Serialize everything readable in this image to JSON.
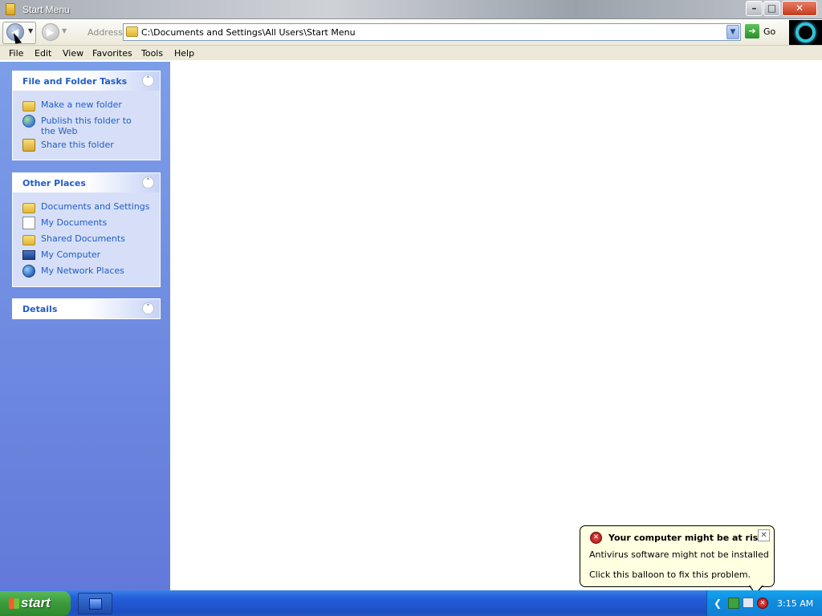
{
  "window": {
    "title": "Start Menu",
    "controls": {
      "minimize": "–",
      "maximize": "□",
      "close": "✕"
    }
  },
  "toolbar": {
    "address_label": "Address",
    "address_value": "C:\\Documents and Settings\\All Users\\Start Menu",
    "go_label": "Go",
    "back_icon": "◀",
    "forward_icon": "▶"
  },
  "menu": [
    "File",
    "Edit",
    "View",
    "Favorites",
    "Tools",
    "Help"
  ],
  "task_pane": {
    "file_folder_tasks": {
      "title": "File and Folder Tasks",
      "items": [
        "Make a new folder",
        "Publish this folder to the Web",
        "Share this folder"
      ]
    },
    "other_places": {
      "title": "Other Places",
      "items": [
        "Documents and Settings",
        "My Documents",
        "Shared Documents",
        "My Computer",
        "My Network Places"
      ]
    },
    "details": {
      "title": "Details"
    }
  },
  "balloon": {
    "title": "Your computer might be at risk",
    "line1": "Antivirus software might not be installed",
    "line2": "Click this balloon to fix this problem.",
    "close": "✕"
  },
  "taskbar": {
    "start_label": "start",
    "clock": "3:15 AM"
  },
  "colors": {
    "link_blue": "#215dc6",
    "pane_gradient_top": "#7c9ee9",
    "pane_gradient_bottom": "#6279d9",
    "taskbar_blue": "#245edb",
    "start_green": "#3a9a3a",
    "balloon_bg": "#ffffe1"
  }
}
